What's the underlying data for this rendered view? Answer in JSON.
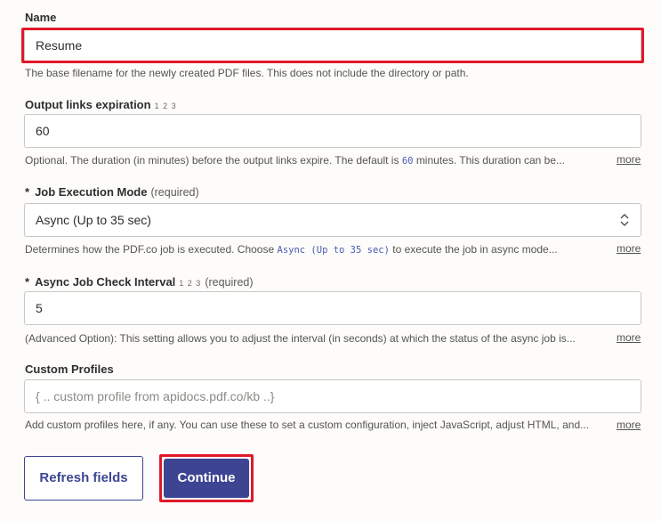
{
  "name_field": {
    "label": "Name",
    "value": "Resume",
    "help": "The base filename for the newly created PDF files. This does not include the directory or path."
  },
  "expiration_field": {
    "label": "Output links expiration",
    "type_hint": "1 2 3",
    "value": "60",
    "help_pre": "Optional. The duration (in minutes) before the output links expire. The default is",
    "help_code": "60",
    "help_post": "minutes. This duration can be...",
    "more": "more"
  },
  "mode_field": {
    "required_mark": "*",
    "label": "Job Execution Mode",
    "required": "(required)",
    "value": "Async (Up to 35 sec)",
    "help_pre": "Determines how the PDF.co job is executed. Choose",
    "help_code": "Async (Up to 35 sec)",
    "help_post": "to execute the job in async mode...",
    "more": "more"
  },
  "interval_field": {
    "required_mark": "*",
    "label": "Async Job Check Interval",
    "type_hint": "1 2 3",
    "required": "(required)",
    "value": "5",
    "help": "(Advanced Option): This setting allows you to adjust the interval (in seconds) at which the status of the async job is...",
    "more": "more"
  },
  "profiles_field": {
    "label": "Custom Profiles",
    "placeholder": "{ .. custom profile from apidocs.pdf.co/kb ..}",
    "help": "Add custom profiles here, if any. You can use these to set a custom configuration, inject JavaScript, adjust HTML, and...",
    "more": "more"
  },
  "buttons": {
    "refresh": "Refresh fields",
    "continue": "Continue"
  },
  "colors": {
    "accent": "#3d4592",
    "highlight": "#e0182a"
  }
}
